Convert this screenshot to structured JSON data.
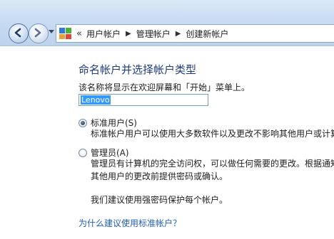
{
  "breadcrumb": {
    "prefix": "«",
    "items": [
      "用户帐户",
      "管理帐户",
      "创建新帐户"
    ]
  },
  "main": {
    "title": "命名帐户并选择帐户类型",
    "description": "该名称将显示在欢迎屏幕和「开始」菜单上。",
    "name_input_value": "Lenovo",
    "options": [
      {
        "label": "标准用户(S)",
        "checked": true,
        "description": [
          "标准帐户用户可以使用大多数软件以及更改不影响其他用户或计算"
        ]
      },
      {
        "label": "管理员(A)",
        "checked": false,
        "description": [
          "管理员有计算机的完全访问权，可以做任何需要的更改。根据通知",
          "其他用户的更改前提供密码或确认。",
          "",
          "我们建议使用强密码保护每个帐户。"
        ]
      }
    ],
    "help_link": "为什么建议使用标准帐户？"
  },
  "colors": {
    "title": "#1f3d7a",
    "link": "#1f5fb4",
    "selection": "#3399ff"
  }
}
